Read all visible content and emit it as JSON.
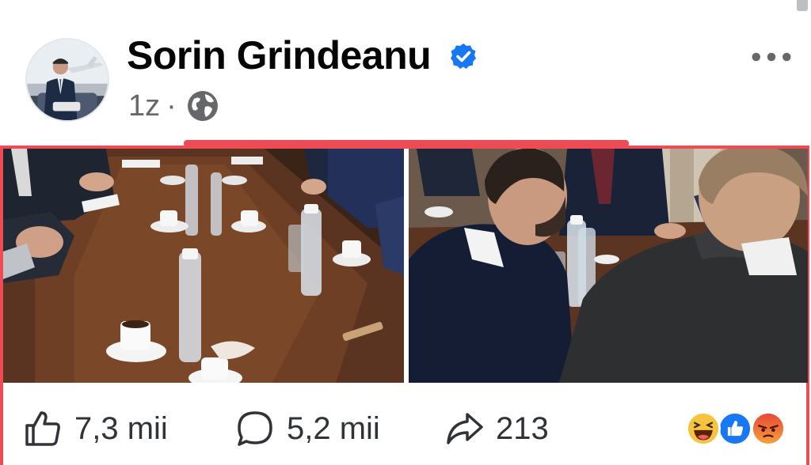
{
  "post": {
    "author": "Sorin Grindeanu",
    "time": "1z",
    "separator": "·",
    "audience_icon": "globe-icon",
    "verified_icon": "verified-badge-icon"
  },
  "photos": [
    {
      "description_icon": "photo-meeting-table"
    },
    {
      "description_icon": "photo-meeting-attendees"
    }
  ],
  "actions": {
    "like_count": "7,3 mii",
    "comment_count": "5,2 mii",
    "share_count": "213"
  },
  "reactions": [
    "haha-icon",
    "like-icon",
    "angry-icon"
  ],
  "colors": {
    "highlight": "#ef4b55",
    "verified": "#1877f2",
    "secondary_text": "#65676b"
  }
}
